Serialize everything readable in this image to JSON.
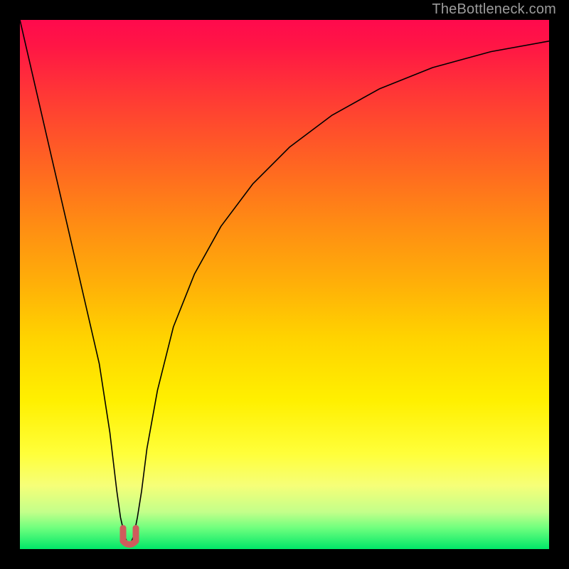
{
  "watermark": "TheBottleneck.com",
  "chart_data": {
    "type": "line",
    "title": "",
    "xlabel": "",
    "ylabel": "",
    "xlim": [
      0,
      1
    ],
    "ylim": [
      0,
      100
    ],
    "grid": false,
    "series": [
      {
        "name": "curve",
        "x": [
          0.0,
          0.03,
          0.06,
          0.09,
          0.12,
          0.15,
          0.17,
          0.183,
          0.19,
          0.198,
          0.203,
          0.207,
          0.21,
          0.215,
          0.222,
          0.23,
          0.24,
          0.26,
          0.29,
          0.33,
          0.38,
          0.44,
          0.51,
          0.59,
          0.68,
          0.78,
          0.89,
          1.0
        ],
        "values": [
          100,
          87,
          74,
          61,
          48,
          35,
          22,
          11,
          6,
          2.5,
          1.2,
          1.0,
          1.2,
          2.5,
          6,
          11,
          19,
          30,
          42,
          52,
          61,
          69,
          76,
          82,
          87,
          91,
          94,
          96
        ]
      }
    ],
    "annotations": {
      "marker": {
        "label": "",
        "x": 0.207,
        "y": 1.0,
        "color": "#cf5c5c"
      }
    },
    "background_gradient_meaning": "score ramp from high (red, top) to low/good (green, bottom)",
    "gradient_stops": [
      {
        "pos": 0,
        "color": "#ff0a4d"
      },
      {
        "pos": 15,
        "color": "#ff3b34"
      },
      {
        "pos": 38,
        "color": "#ff8a14"
      },
      {
        "pos": 60,
        "color": "#ffd300"
      },
      {
        "pos": 82,
        "color": "#ffff3a"
      },
      {
        "pos": 93,
        "color": "#c3ff8a"
      },
      {
        "pos": 100,
        "color": "#00e768"
      }
    ]
  }
}
